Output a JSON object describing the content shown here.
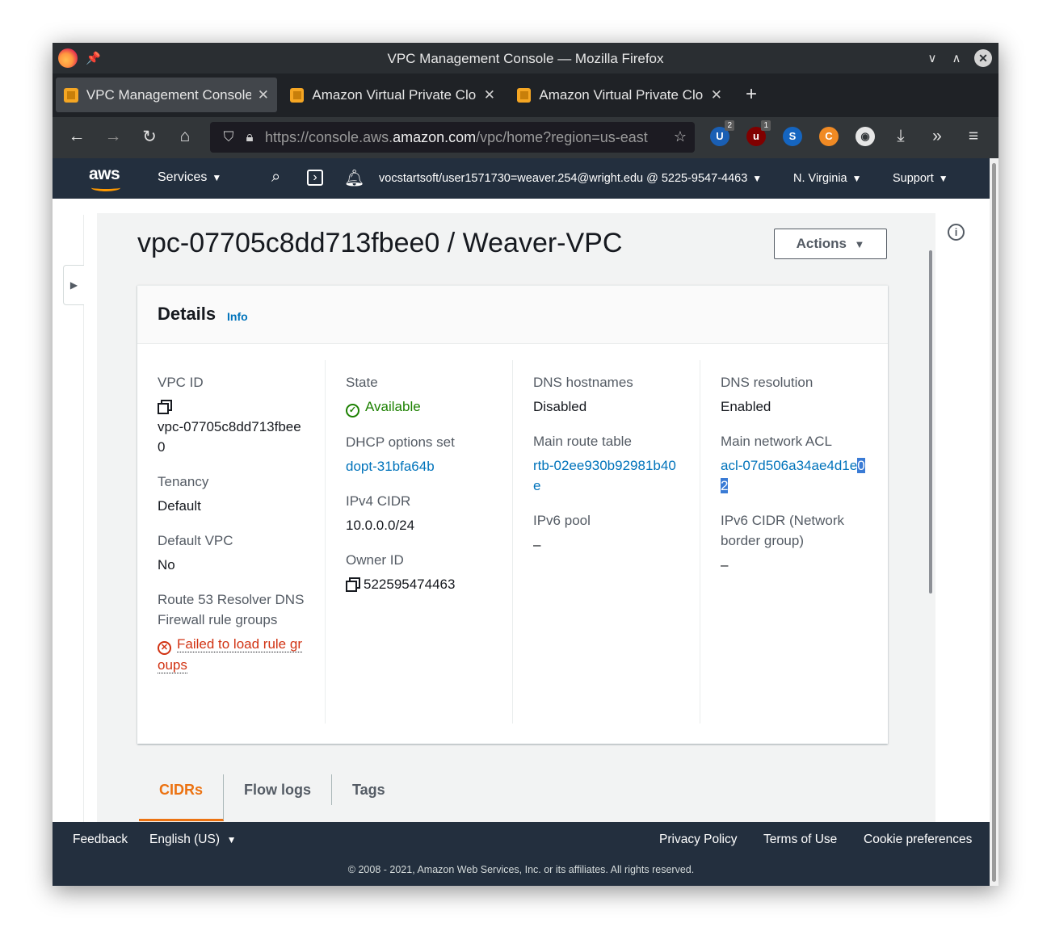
{
  "window": {
    "title": "VPC Management Console — Mozilla Firefox",
    "firefox_icon": "firefox-logo",
    "pin_icon": "pin-icon",
    "minimize_glyph": "∨",
    "maximize_glyph": "∧",
    "close_glyph": "✕"
  },
  "tabs": [
    {
      "label": "VPC Management Console",
      "close": "✕",
      "active": true
    },
    {
      "label": "Amazon Virtual Private Clo",
      "close": "✕",
      "active": false
    },
    {
      "label": "Amazon Virtual Private Clo",
      "close": "✕",
      "active": false
    }
  ],
  "new_tab_glyph": "+",
  "toolbar": {
    "back_glyph": "←",
    "forward_glyph": "→",
    "reload_glyph": "↻",
    "home_glyph": "⌂",
    "url_prefix": "https://console.aws.",
    "url_domain": "amazon.com",
    "url_suffix": "/vpc/home?region=us-east",
    "extensions": [
      {
        "name": "ublock-extension",
        "glyph": "U",
        "badge": "2",
        "color": "#1a5fb4"
      },
      {
        "name": "ublock-origin-extension",
        "glyph": "u",
        "badge": "1",
        "color": "#800000"
      },
      {
        "name": "s-extension",
        "glyph": "S",
        "badge": "",
        "color": "#1565c0"
      },
      {
        "name": "c-extension",
        "glyph": "C",
        "badge": "",
        "color": "#f08a24"
      },
      {
        "name": "eye-extension",
        "glyph": "◉",
        "badge": "",
        "color": "#e6e6e6"
      }
    ],
    "download_glyph": "⤓",
    "overflow_glyph": "»",
    "menu_glyph": "≡"
  },
  "aws_header": {
    "logo": "aws",
    "services": "Services",
    "account": "vocstartsoft/user1571730=weaver.254@wright.edu @ 5225-9547-4463",
    "region": "N. Virginia",
    "support": "Support",
    "caret": "▼"
  },
  "page": {
    "title": "vpc-07705c8dd713fbee0 / Weaver-VPC",
    "actions_label": "Actions",
    "actions_caret": "▼",
    "info_glyph": "i",
    "rail_toggle_glyph": "▶"
  },
  "details": {
    "heading": "Details",
    "info_link": "Info",
    "columns": [
      [
        {
          "label": "VPC ID",
          "value": "vpc-07705c8dd713fbee0",
          "kind": "copy-block"
        },
        {
          "label": "Tenancy",
          "value": "Default",
          "kind": "text"
        },
        {
          "label": "Default VPC",
          "value": "No",
          "kind": "text"
        },
        {
          "label": "Route 53 Resolver DNS Firewall rule groups",
          "value": "Failed to load rule groups",
          "kind": "error"
        }
      ],
      [
        {
          "label": "State",
          "value": "Available",
          "kind": "ok"
        },
        {
          "label": "DHCP options set",
          "value": "dopt-31bfa64b",
          "kind": "link"
        },
        {
          "label": "IPv4 CIDR",
          "value": "10.0.0.0/24",
          "kind": "text"
        },
        {
          "label": "Owner ID",
          "value": "522595474463",
          "kind": "copy-inline"
        }
      ],
      [
        {
          "label": "DNS hostnames",
          "value": "Disabled",
          "kind": "text"
        },
        {
          "label": "Main route table",
          "value": "rtb-02ee930b92981b40e",
          "kind": "link"
        },
        {
          "label": "IPv6 pool",
          "value": "–",
          "kind": "text"
        }
      ],
      [
        {
          "label": "DNS resolution",
          "value": "Enabled",
          "kind": "text"
        },
        {
          "label": "Main network ACL",
          "value": "acl-07d506a34ae4d1e",
          "value_selected": "02",
          "kind": "link"
        },
        {
          "label": "IPv6 CIDR (Network border group)",
          "value": "–",
          "kind": "text"
        }
      ]
    ]
  },
  "detail_tabs": [
    {
      "label": "CIDRs",
      "active": true
    },
    {
      "label": "Flow logs",
      "active": false
    },
    {
      "label": "Tags",
      "active": false
    }
  ],
  "footer": {
    "feedback": "Feedback",
    "language": "English (US)",
    "language_caret": "▼",
    "privacy": "Privacy Policy",
    "terms": "Terms of Use",
    "cookies": "Cookie preferences",
    "copyright": "© 2008 - 2021, Amazon Web Services, Inc. or its affiliates. All rights reserved."
  },
  "colors": {
    "aws_header": "#232f3e",
    "link": "#0073bb",
    "success": "#1d8102",
    "error": "#d13212",
    "tab_active": "#ec7211"
  }
}
